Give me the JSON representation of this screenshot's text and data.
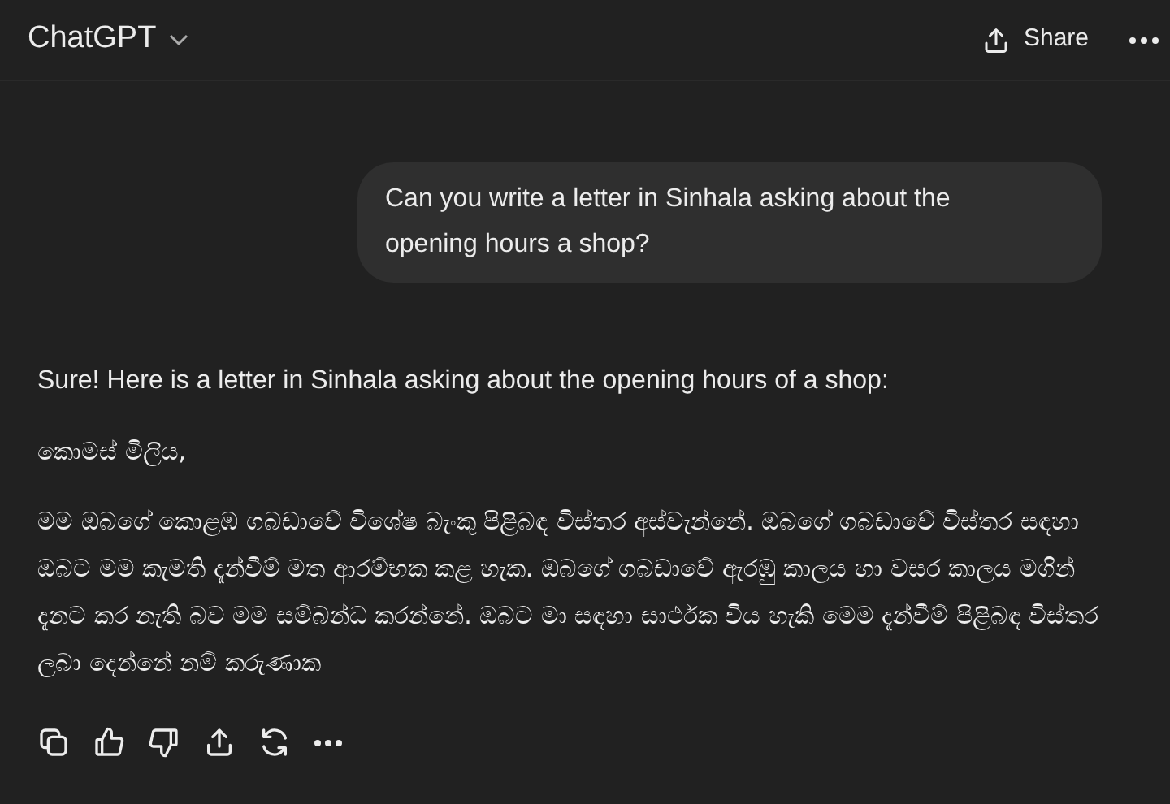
{
  "header": {
    "title": "ChatGPT",
    "share": "Share"
  },
  "user_message": {
    "text": "Can you write a letter in Sinhala asking about the opening hours a shop?"
  },
  "assistant_message": {
    "paragraphs": [
      "Sure! Here is a letter in Sinhala asking about the opening hours of a shop:",
      "කොමස් මිලිය,",
      "මම ඔබගේ කොළඹ ගබඩාවේ විශේෂ බැංකු පිළිබඳ විස්තර අස්වැන්නේ. ඔබගේ ගබඩාවේ විස්තර සඳහා ඔබට මම කැමති දැන්වීම් මත ආරම්භක කළ හැක. ඔබගේ ගබඩාවේ ඇරඹු කාලය හා වසර කාලය මගින් දැනට කර නැති බව මම සම්බන්ධ කරන්නේ. ඔබට මා සඳහා සාර්ථක විය හැකි මෙම දැන්වීම් පිළිබඳ විස්තර ලබා දෙන්නේ නම් කරුණාක"
    ]
  }
}
